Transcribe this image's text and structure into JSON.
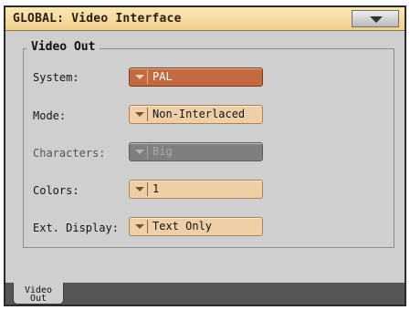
{
  "window": {
    "title": "GLOBAL: Video Interface"
  },
  "group": {
    "title": "Video Out"
  },
  "rows": [
    {
      "label": "System:",
      "value": "PAL",
      "state": "selected"
    },
    {
      "label": "Mode:",
      "value": "Non-Interlaced",
      "state": "normal"
    },
    {
      "label": "Characters:",
      "value": "Big",
      "state": "disabled"
    },
    {
      "label": "Colors:",
      "value": "1",
      "state": "normal"
    },
    {
      "label": "Ext. Display:",
      "value": "Text Only",
      "state": "normal"
    }
  ],
  "tabs": [
    {
      "line1": "Video",
      "line2": "Out",
      "active": true
    }
  ],
  "icons": {
    "page_menu": "triangle-down-icon",
    "dropdown": "dropdown-arrow-icon"
  },
  "colors": {
    "titlebar": "#f4d89e",
    "field": "#efcfa7",
    "field_selected": "#c46a40",
    "field_disabled": "#7f7f7f",
    "panel": "#cfcfcf"
  }
}
